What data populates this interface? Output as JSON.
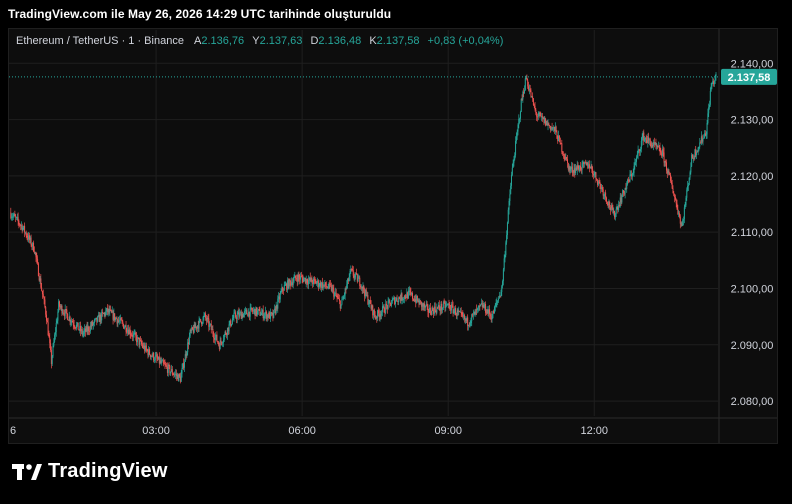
{
  "header": {
    "caption": "TradingView.com ile May 26, 2026 14:29 UTC tarihinde oluşturuldu"
  },
  "legend": {
    "symbol": "Ethereum / TetherUS · 1 · Binance",
    "open_label": "A",
    "open_value": "2.136,76",
    "high_label": "Y",
    "high_value": "2.137,63",
    "low_label": "D",
    "low_value": "2.136,48",
    "close_label": "K",
    "close_value": "2.137,58",
    "change": "+0,83 (+0,04%)"
  },
  "brand": {
    "name": "TradingView",
    "logo_icon": "tradingview-logo-icon"
  },
  "colors": {
    "up": "#26a69a",
    "down": "#ef5350",
    "grid": "#1f1f1f",
    "axis_text": "#d1d4dc",
    "price_badge": "#26a69a",
    "background": "#000000"
  },
  "chart_data": {
    "type": "candlestick",
    "title": "Ethereum / TetherUS · 1 · Binance",
    "x_ticks": [
      "6",
      "03:00",
      "06:00",
      "09:00",
      "12:00"
    ],
    "x_tick_hours": [
      0,
      3,
      6,
      9,
      12
    ],
    "x_range_hours": [
      0,
      14.5
    ],
    "y_ticks": [
      2080,
      2090,
      2100,
      2110,
      2120,
      2130,
      2140
    ],
    "y_tick_labels": [
      "2.080,00",
      "2.090,00",
      "2.100,00",
      "2.110,00",
      "2.120,00",
      "2.130,00",
      "2.140,00"
    ],
    "ylim": [
      2077,
      2142
    ],
    "last_price": 2137.58,
    "last_price_label": "2.137,58",
    "grid": true,
    "path_hours": [
      0,
      0.25,
      0.5,
      0.75,
      0.85,
      1.0,
      1.5,
      2.0,
      2.4,
      2.8,
      3.2,
      3.5,
      3.7,
      4.0,
      4.3,
      4.6,
      5.0,
      5.4,
      5.6,
      5.9,
      6.3,
      6.6,
      6.8,
      7.0,
      7.2,
      7.5,
      7.9,
      8.2,
      8.6,
      9.0,
      9.4,
      9.7,
      9.9,
      10.1,
      10.3,
      10.5,
      10.6,
      10.8,
      11.2,
      11.5,
      11.9,
      12.2,
      12.4,
      12.8,
      13.0,
      13.4,
      13.6,
      13.8,
      14.0,
      14.3,
      14.4,
      14.5
    ],
    "path_prices": [
      2113.5,
      2111,
      2107,
      2095,
      2087,
      2097,
      2092,
      2096,
      2093,
      2089,
      2086,
      2084,
      2092,
      2095,
      2090,
      2095,
      2096,
      2095,
      2100,
      2102,
      2101,
      2100,
      2097,
      2103,
      2101,
      2095,
      2098,
      2099,
      2096,
      2097,
      2094,
      2097,
      2095,
      2100,
      2120,
      2133,
      2137.5,
      2131,
      2128,
      2121,
      2122,
      2117,
      2113,
      2121,
      2127,
      2124,
      2118,
      2111,
      2123,
      2128,
      2136,
      2137.58
    ],
    "candle_interval_minutes": 1
  }
}
